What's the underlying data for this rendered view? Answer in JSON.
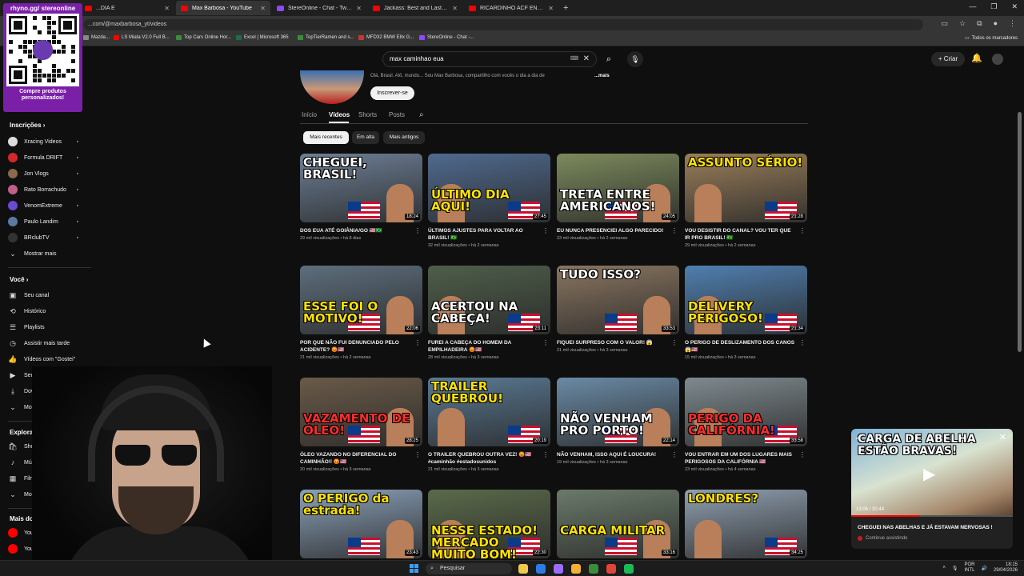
{
  "browser": {
    "tabs": [
      {
        "label": "...DIA E",
        "color": "#ff0000",
        "active": false
      },
      {
        "label": "Max Barbosa - YouTube",
        "color": "#ff0000",
        "active": true
      },
      {
        "label": "StereOnline - Chat - Twitch",
        "color": "#9146ff",
        "active": false
      },
      {
        "label": "Jackass: Best and Last Trailer #",
        "color": "#ff0000",
        "active": false
      },
      {
        "label": "RICARDINHO ACF ENCONTRO",
        "color": "#ff0000",
        "active": false
      }
    ],
    "new_tab": "+",
    "url": "...com/@maxbarbosa_yt/videos",
    "bookmarks": [
      {
        "label": "Mazda...",
        "color": "#888888"
      },
      {
        "label": "LS Miata V2.0 Full B...",
        "color": "#ff0000"
      },
      {
        "label": "Top Cars Online Hor...",
        "color": "#3a8e3a"
      },
      {
        "label": "Excel | Microsoft 365",
        "color": "#1d6f42"
      },
      {
        "label": "TopTierRamen and s...",
        "color": "#3a8e3a"
      },
      {
        "label": "MFD32 BMW E8x G...",
        "color": "#cc3333"
      },
      {
        "label": "StereOnline - Chat -...",
        "color": "#9146ff"
      }
    ],
    "all_bookmarks": "Todos os marcadores"
  },
  "overlay": {
    "qr_title": "rhyno.gg/ stereonline",
    "qr_caption": "Compre produtos personalizados!"
  },
  "header": {
    "search_value": "max caminhao eua",
    "create_label": "Criar"
  },
  "sidebar": {
    "subs_title": "Inscrições",
    "subs": [
      {
        "label": "Xracing Videos",
        "color": "#dddddd"
      },
      {
        "label": "Formula DRIFT",
        "color": "#d62828"
      },
      {
        "label": "Jon Vlogs",
        "color": "#8a6a4a"
      },
      {
        "label": "Rato Borrachudo",
        "color": "#c0608a"
      },
      {
        "label": "VenomExtreme",
        "color": "#6a4ad0"
      },
      {
        "label": "Paulo Landim",
        "color": "#5a7aa0"
      },
      {
        "label": "BRclubTV",
        "color": "#333333"
      }
    ],
    "show_more": "Mostrar mais",
    "you_title": "Você",
    "you": [
      {
        "label": "Seu canal",
        "icon": "channel-icon",
        "glyph": "▣"
      },
      {
        "label": "Histórico",
        "icon": "history-icon",
        "glyph": "⟲"
      },
      {
        "label": "Playlists",
        "icon": "playlist-icon",
        "glyph": "☰"
      },
      {
        "label": "Assistir mais tarde",
        "icon": "clock-icon",
        "glyph": "◷"
      },
      {
        "label": "Vídeos com \"Gostei\"",
        "icon": "thumbs-up-icon",
        "glyph": "👍"
      },
      {
        "label": "Seus vídeos",
        "icon": "video-icon",
        "glyph": "▶"
      },
      {
        "label": "Downloads",
        "icon": "download-icon",
        "glyph": "⤓"
      }
    ],
    "show_more_2": "Mostrar mais",
    "explore_title": "Explorar",
    "explore": [
      {
        "label": "Shopping",
        "icon": "shopping-icon",
        "glyph": "🛍"
      },
      {
        "label": "Música",
        "icon": "music-icon",
        "glyph": "♪"
      },
      {
        "label": "Filmes",
        "icon": "movies-icon",
        "glyph": "▦"
      }
    ],
    "show_more_3": "Mostrar mais",
    "more_title": "Mais do YouTube",
    "more": [
      {
        "label": "YouTube",
        "color": "#ff0000"
      },
      {
        "label": "YouT...",
        "color": "#ff0000"
      }
    ]
  },
  "channel": {
    "description": "Olá, Brasil. Alô, mundo... Sou Max Barbosa, compartilho com vocês o dia a dia de",
    "more": "...mais",
    "subscribe": "Inscrever-se",
    "tabs": [
      "Início",
      "Vídeos",
      "Shorts",
      "Posts"
    ],
    "active_tab": "Vídeos",
    "chips": [
      "Mais recentes",
      "Em alta",
      "Mais antigos"
    ],
    "active_chip": "Mais recentes"
  },
  "videos": [
    {
      "title": "DOS EUA ATÉ GOIÂNIA/GO 🇺🇸🇧🇷",
      "views": "29 mil visualizações",
      "age": "há 8 dias",
      "duration": "18:24",
      "caption": "CHEGUEI, BRASIL!",
      "bg": "#6d7f96"
    },
    {
      "title": "ÚLTIMOS AJUSTES PARA VOLTAR AO BRASIL! 🇧🇷",
      "views": "32 mil visualizações",
      "age": "há 2 semanas",
      "duration": "27:45",
      "caption": "ÚLTIMO DIA AQUI!",
      "bg": "#4f6a8f"
    },
    {
      "title": "EU NUNCA PRESENCIEI ALGO PARECIDO!",
      "views": "23 mil visualizações",
      "age": "há 2 semanas",
      "duration": "24:05",
      "caption": "TRETA ENTRE AMERICANOS!",
      "bg": "#7c8a5c"
    },
    {
      "title": "VOU DESISTIR DO CANAL? VOU TER QUE IR PRO BRASIL! 🇧🇷",
      "views": "29 mil visualizações",
      "age": "há 2 semanas",
      "duration": "21:28",
      "caption": "ASSUNTO SÉRIO!",
      "bg": "#9a7e5a"
    },
    {
      "title": "POR QUE NÃO FUI DENUNCIADO PELO ACIDENTE? 😡🇺🇸",
      "views": "21 mil visualizações",
      "age": "há 2 semanas",
      "duration": "22:06",
      "caption": "ESSE FOI O MOTIVO!",
      "bg": "#5d6e7d"
    },
    {
      "title": "FUREI A CABEÇA DO HOMEM DA EMPILHADEIRA 😡🇺🇸",
      "views": "28 mil visualizações",
      "age": "há 3 semanas",
      "duration": "23:11",
      "caption": "ACERTOU NA CABEÇA!",
      "bg": "#4e5e4a"
    },
    {
      "title": "FIQUEI SURPRESO COM O VALOR! 😱",
      "views": "21 mil visualizações",
      "age": "há 3 semanas",
      "duration": "33:53",
      "caption": "TUDO ISSO?",
      "bg": "#8a7560"
    },
    {
      "title": "O PERIGO DE DESLIZAMENTO DOS CANOS 😱🇺🇸",
      "views": "15 mil visualizações",
      "age": "há 3 semanas",
      "duration": "21:34",
      "caption": "DELIVERY PERIGOSO!",
      "bg": "#4f7fb0"
    },
    {
      "title": "ÓLEO VAZANDO NO DIFERENCIAL DO CAMINHÃO!! 😡🇺🇸",
      "views": "20 mil visualizações",
      "age": "há 3 semanas",
      "duration": "28:25",
      "caption": "VAZAMENTO DE ÓLEO!",
      "bg": "#6a5a48"
    },
    {
      "title": "O TRAILER QUEBROU OUTRA VEZ! 😡🇺🇸 #caminhão #estadosunidos",
      "views": "21 mil visualizações",
      "age": "há 3 semanas",
      "duration": "20:19",
      "caption": "TRAILER QUEBROU!",
      "bg": "#5a7a95"
    },
    {
      "title": "NÃO VENHAM, ISSO AQUI É LOUCURA!",
      "views": "19 mil visualizações",
      "age": "há 3 semanas",
      "duration": "22:14",
      "caption": "NÃO VENHAM PRO PORTO!",
      "bg": "#6a8aa5"
    },
    {
      "title": "VOU ENTRAR EM UM DOS LUGARES MAIS PERIGOSOS DA CALIFÓRNIA 🇺🇸",
      "views": "23 mil visualizações",
      "age": "há 4 semanas",
      "duration": "33:58",
      "caption": "PERIGO DA CALIFÓRNIA!",
      "bg": "#7f8a8f"
    },
    {
      "title": "",
      "views": "",
      "age": "",
      "duration": "23:43",
      "caption": "O PERIGO da estrada!",
      "bg": "#8aa0b8"
    },
    {
      "title": "",
      "views": "",
      "age": "",
      "duration": "22:30",
      "caption": "NESSE ESTADO! MERCADO MUITO BOM!",
      "bg": "#5a6a4a"
    },
    {
      "title": "",
      "views": "",
      "age": "",
      "duration": "33:16",
      "caption": "CARGA MILITAR",
      "bg": "#6a7a6a"
    },
    {
      "title": "",
      "views": "",
      "age": "",
      "duration": "34:25",
      "caption": "LONDRES?",
      "bg": "#8f9fb0"
    }
  ],
  "miniplayer": {
    "caption": "CARGA DE ABELHA ESTÃO BRAVAS!",
    "time": "13:06 / 30:44",
    "progress": 0.426,
    "title": "CHEGUEI NAS ABELHAS E JÁ ESTAVAM NERVOSAS !",
    "subtitle": "Continue assistindo"
  },
  "taskbar": {
    "search": "Pesquisar",
    "lang_top": "POR",
    "lang_bottom": "INTL",
    "time": "18:15",
    "date": "29/04/2026",
    "apps": [
      {
        "name": "file-explorer-icon",
        "color": "#f2c94c"
      },
      {
        "name": "store-icon",
        "color": "#2d7be5"
      },
      {
        "name": "copilot-icon",
        "color": "#9b6cff"
      },
      {
        "name": "folder-icon",
        "color": "#f2b134"
      },
      {
        "name": "media-icon",
        "color": "#3a8e3a"
      },
      {
        "name": "chrome-icon",
        "color": "#e0453a"
      },
      {
        "name": "spotify-icon",
        "color": "#1db954"
      }
    ]
  }
}
